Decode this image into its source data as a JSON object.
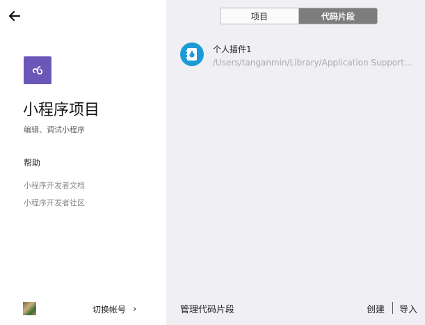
{
  "sidebar": {
    "title": "小程序项目",
    "subtitle": "编辑、调试小程序",
    "help_heading": "帮助",
    "links": [
      "小程序开发者文档",
      "小程序开发者社区"
    ],
    "switch_account": "切换帐号",
    "chevron": "›",
    "logo_color": "#6a57b8"
  },
  "tabs": {
    "items": [
      "项目",
      "代码片段"
    ],
    "selected": "代码片段"
  },
  "snippets": [
    {
      "name": "个人插件1",
      "path": "/Users/tanganmin/Library/Application Support/微信...",
      "icon": "plugin-icon",
      "icon_color": "#1d9bd7"
    }
  ],
  "footer": {
    "manage": "管理代码片段",
    "create": "创建",
    "import": "导入"
  }
}
